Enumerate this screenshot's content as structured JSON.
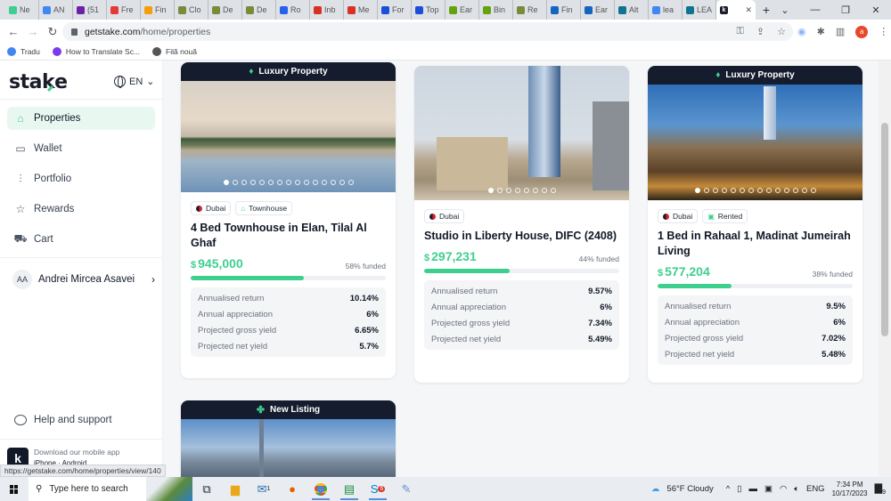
{
  "browser": {
    "tabs": [
      {
        "label": "Ne",
        "color": "#3ecf8e"
      },
      {
        "label": "AN",
        "color": "#4285f4"
      },
      {
        "label": "(51",
        "color": "#6b21a8"
      },
      {
        "label": "Fre",
        "color": "#e53935"
      },
      {
        "label": "Fin",
        "color": "#f59e0b"
      },
      {
        "label": "Clo",
        "color": "#7a8a3a"
      },
      {
        "label": "De",
        "color": "#7a8a3a"
      },
      {
        "label": "De",
        "color": "#7a8a3a"
      },
      {
        "label": "Ro",
        "color": "#2563eb"
      },
      {
        "label": "Inb",
        "color": "#d93025"
      },
      {
        "label": "Me",
        "color": "#d93025"
      },
      {
        "label": "For",
        "color": "#1d4ed8"
      },
      {
        "label": "Top",
        "color": "#1d4ed8"
      },
      {
        "label": "Ear",
        "color": "#65a30d"
      },
      {
        "label": "Bin",
        "color": "#65a30d"
      },
      {
        "label": "Re",
        "color": "#7a8a3a"
      },
      {
        "label": "Fin",
        "color": "#1565c0"
      },
      {
        "label": "Ear",
        "color": "#1565c0"
      },
      {
        "label": "Alt",
        "color": "#0e7490"
      },
      {
        "label": "lea",
        "color": "#4285f4"
      },
      {
        "label": "LEA",
        "color": "#0e7490"
      }
    ],
    "active_tab": {
      "favicon": "k",
      "close": "✕"
    },
    "new_tab": "+",
    "window_controls": {
      "dropdown": "⌄",
      "minimize": "—",
      "maximize": "❐",
      "close": "✕"
    },
    "url_host": "getstake.com",
    "url_path": "/home/properties",
    "bookmarks": [
      {
        "label": "Tradu",
        "color": "#4285f4"
      },
      {
        "label": "How to Translate Sc...",
        "color": "#7c3aed"
      },
      {
        "label": "Filă nouă",
        "color": "#555"
      }
    ],
    "profile_initial": "a",
    "status_url": "https://getstake.com/home/properties/view/140"
  },
  "sidebar": {
    "logo": "stake",
    "language": "EN",
    "nav": [
      {
        "label": "Properties",
        "icon": "home-icon",
        "glyph": "⌂",
        "active": true
      },
      {
        "label": "Wallet",
        "icon": "wallet-icon",
        "glyph": "▭",
        "active": false
      },
      {
        "label": "Portfolio",
        "icon": "portfolio-icon",
        "glyph": "⫶",
        "active": false
      },
      {
        "label": "Rewards",
        "icon": "star-icon",
        "glyph": "☆",
        "active": false
      },
      {
        "label": "Cart",
        "icon": "cart-icon",
        "glyph": "⛟",
        "active": false
      }
    ],
    "user": {
      "initials": "AA",
      "name": "Andrei Mircea Asavei"
    },
    "help": "Help and support",
    "app_download": {
      "title": "Download our mobile app",
      "platforms": "iPhone  ·  Android"
    }
  },
  "properties": [
    {
      "banner": "Luxury Property",
      "tags": [
        {
          "label": "Dubai",
          "type": "flag"
        },
        {
          "label": "Townhouse",
          "type": "house"
        }
      ],
      "title": "4 Bed Townhouse in Elan, Tilal Al Ghaf",
      "currency": "$",
      "price": "945,000",
      "funded_label": "58% funded",
      "funded": 58,
      "image_count": 15,
      "stats": [
        {
          "label": "Annualised return",
          "value": "10.14%"
        },
        {
          "label": "Annual appreciation",
          "value": "6%"
        },
        {
          "label": "Projected gross yield",
          "value": "6.65%"
        },
        {
          "label": "Projected net yield",
          "value": "5.7%"
        }
      ]
    },
    {
      "banner": null,
      "tags": [
        {
          "label": "Dubai",
          "type": "flag"
        }
      ],
      "title": "Studio in Liberty House, DIFC (2408)",
      "currency": "$",
      "price": "297,231",
      "funded_label": "44% funded",
      "funded": 44,
      "image_count": 8,
      "stats": [
        {
          "label": "Annualised return",
          "value": "9.57%"
        },
        {
          "label": "Annual appreciation",
          "value": "6%"
        },
        {
          "label": "Projected gross yield",
          "value": "7.34%"
        },
        {
          "label": "Projected net yield",
          "value": "5.49%"
        }
      ]
    },
    {
      "banner": "Luxury Property",
      "tags": [
        {
          "label": "Dubai",
          "type": "flag"
        },
        {
          "label": "Rented",
          "type": "rented"
        }
      ],
      "title": "1 Bed in Rahaal 1, Madinat Jumeirah Living",
      "currency": "$",
      "price": "577,204",
      "funded_label": "38% funded",
      "funded": 38,
      "image_count": 14,
      "stats": [
        {
          "label": "Annualised return",
          "value": "9.5%"
        },
        {
          "label": "Annual appreciation",
          "value": "6%"
        },
        {
          "label": "Projected gross yield",
          "value": "7.02%"
        },
        {
          "label": "Projected net yield",
          "value": "5.48%"
        }
      ]
    },
    {
      "banner": "New Listing"
    }
  ],
  "taskbar": {
    "search_placeholder": "Type here to search",
    "mail_badge": "1",
    "skype_badge": "6",
    "weather": "56°F  Cloudy",
    "lang": "ENG",
    "time": "7:34 PM",
    "date": "10/17/2023",
    "notifications": "9"
  }
}
